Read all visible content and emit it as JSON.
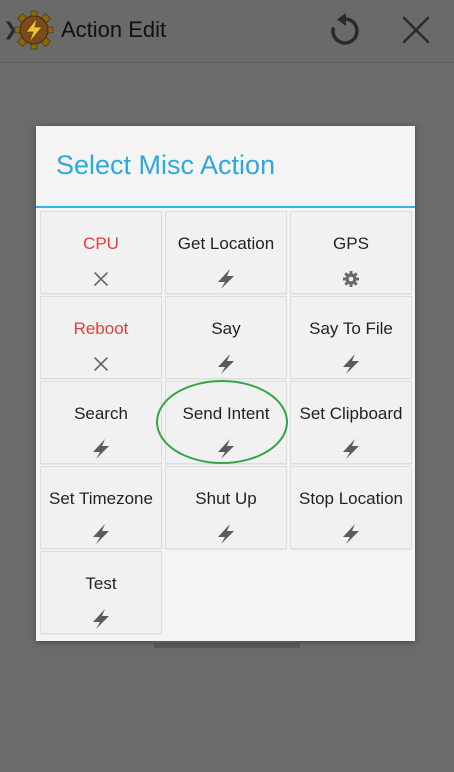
{
  "actionbar": {
    "title": "Action Edit",
    "up_icon": "chevron-left-icon",
    "app_icon": "tasker-app-icon",
    "undo_icon": "undo-icon",
    "close_icon": "close-icon"
  },
  "dialog": {
    "title": "Select Misc Action",
    "accent_color": "#33b5e5",
    "items": [
      {
        "label": "CPU",
        "icon": "close-icon",
        "color": "#e53d3d"
      },
      {
        "label": "Get Location",
        "icon": "lightning-icon"
      },
      {
        "label": "GPS",
        "icon": "gear-icon"
      },
      {
        "label": "Reboot",
        "icon": "close-icon",
        "color": "#e53d3d"
      },
      {
        "label": "Say",
        "icon": "lightning-icon"
      },
      {
        "label": "Say To File",
        "icon": "lightning-icon"
      },
      {
        "label": "Search",
        "icon": "lightning-icon"
      },
      {
        "label": "Send Intent",
        "icon": "lightning-icon",
        "highlighted": true
      },
      {
        "label": "Set Clipboard",
        "icon": "lightning-icon"
      },
      {
        "label": "Set Timezone",
        "icon": "lightning-icon"
      },
      {
        "label": "Shut Up",
        "icon": "lightning-icon"
      },
      {
        "label": "Stop Location",
        "icon": "lightning-icon"
      },
      {
        "label": "Test",
        "icon": "lightning-icon"
      }
    ]
  },
  "annotation": {
    "highlight_color": "#33a64a"
  }
}
